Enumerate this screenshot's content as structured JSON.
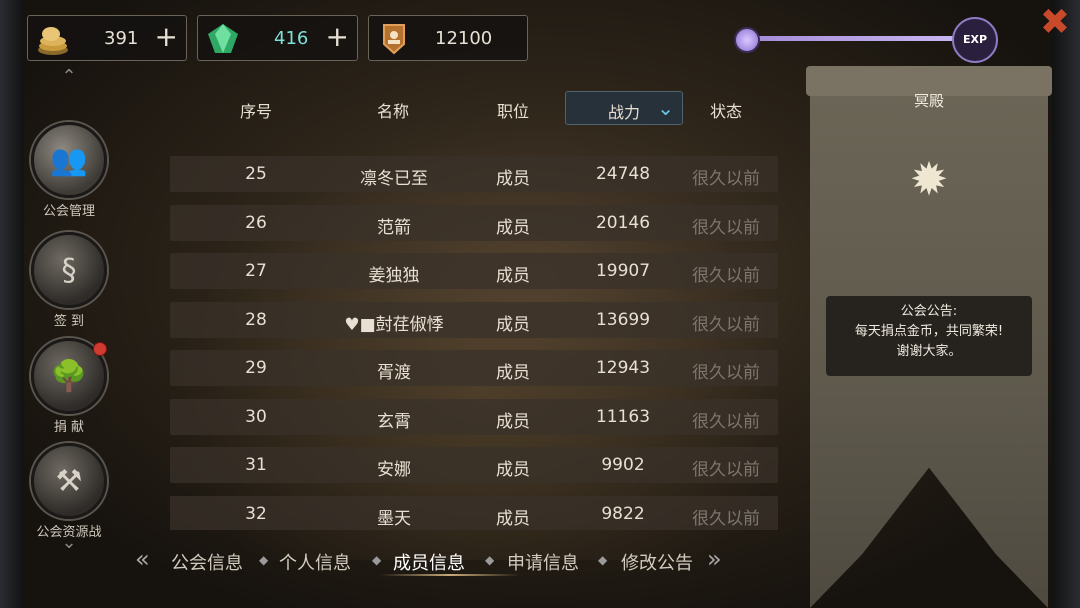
{
  "resources": {
    "gold": {
      "value": "391",
      "icon": "gold-coins-icon"
    },
    "gem": {
      "value": "416",
      "icon": "green-gem-icon"
    },
    "power": {
      "value": "12100",
      "icon": "power-shield-icon"
    }
  },
  "exp": {
    "badge": "EXP",
    "progress": 1.0
  },
  "sidebar": {
    "items": [
      {
        "label": "公会管理",
        "icon": "guild-people-icon",
        "active": true
      },
      {
        "label": "签 到",
        "icon": "sign-in-scroll-icon"
      },
      {
        "label": "捐 献",
        "icon": "tree-icon",
        "notification": true
      },
      {
        "label": "公会资源战",
        "icon": "resource-bag-icon"
      }
    ]
  },
  "table": {
    "headers": {
      "index": "序号",
      "name": "名称",
      "role": "职位",
      "power": "战力",
      "status": "状态"
    },
    "rows": [
      {
        "index": "25",
        "name": "凛冬已至",
        "role": "成员",
        "power": "24748",
        "status": "很久以前"
      },
      {
        "index": "26",
        "name": "范箭",
        "role": "成员",
        "power": "20146",
        "status": "很久以前"
      },
      {
        "index": "27",
        "name": "姜独独",
        "role": "成员",
        "power": "19907",
        "status": "很久以前"
      },
      {
        "index": "28",
        "name": "♥■尌荏俶悸",
        "role": "成员",
        "power": "13699",
        "status": "很久以前"
      },
      {
        "index": "29",
        "name": "胥渡",
        "role": "成员",
        "power": "12943",
        "status": "很久以前"
      },
      {
        "index": "30",
        "name": "玄霄",
        "role": "成员",
        "power": "11163",
        "status": "很久以前"
      },
      {
        "index": "31",
        "name": "安娜",
        "role": "成员",
        "power": "9902",
        "status": "很久以前"
      },
      {
        "index": "32",
        "name": "墨天",
        "role": "成员",
        "power": "9822",
        "status": "很久以前"
      }
    ]
  },
  "tabs": [
    {
      "label": "公会信息"
    },
    {
      "label": "个人信息"
    },
    {
      "label": "成员信息",
      "active": true
    },
    {
      "label": "申请信息"
    },
    {
      "label": "修改公告"
    }
  ],
  "banner": {
    "title": "冥殿",
    "notice_lines": [
      "公会公告:",
      "每天捐点金币，共同繁荣!",
      "谢谢大家。"
    ]
  }
}
